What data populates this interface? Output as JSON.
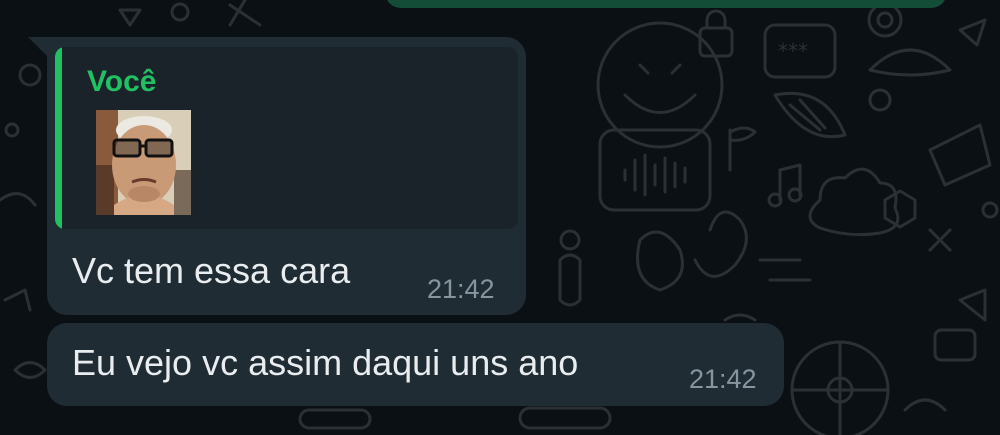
{
  "chat": {
    "messages": [
      {
        "quoted": {
          "author": "Você",
          "media": "photo-thumbnail"
        },
        "text": "Vc tem essa cara",
        "time": "21:42"
      },
      {
        "text": "Eu vejo vc assim daqui uns ano",
        "time": "21:42"
      }
    ]
  },
  "colors": {
    "background": "#0b1014",
    "incoming_bubble": "#1f2c34",
    "quote_background": "#1a2329",
    "quote_accent": "#21c063",
    "outgoing_bubble": "#134d37",
    "text": "#e9edef",
    "timestamp": "#8696a0"
  }
}
